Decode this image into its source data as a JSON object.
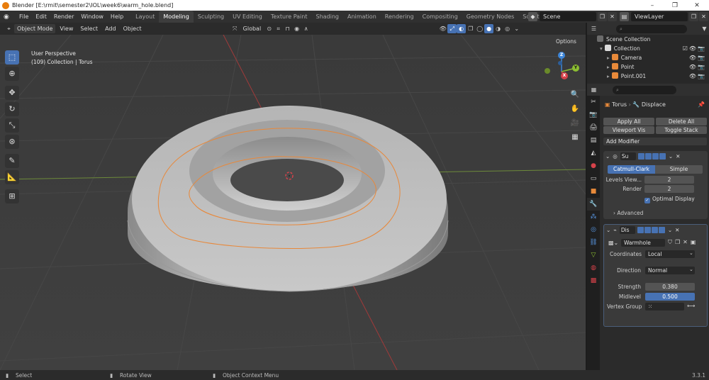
{
  "titlebar": {
    "title": "Blender [E:\\rmit\\semester2\\IOL\\week6\\warm_hole.blend]",
    "min": "–",
    "max": "❐",
    "close": "✕"
  },
  "menu": {
    "items": [
      "File",
      "Edit",
      "Render",
      "Window",
      "Help"
    ]
  },
  "workspace_tabs": [
    "Layout",
    "Modeling",
    "Sculpting",
    "UV Editing",
    "Texture Paint",
    "Shading",
    "Animation",
    "Rendering",
    "Compositing",
    "Geometry Nodes",
    "Scripting"
  ],
  "workspace_active": "Modeling",
  "scene": "Scene",
  "view_layer": "ViewLayer",
  "viewport_header": {
    "mode": "Object Mode",
    "menus": [
      "View",
      "Select",
      "Add",
      "Object"
    ],
    "transform_orientation": "Global"
  },
  "viewport": {
    "perspective": "User Perspective",
    "collection_info": "(109) Collection | Torus",
    "options_label": "Options",
    "gizmo": {
      "x": "X",
      "y": "Y",
      "z": "Z"
    }
  },
  "statusbar": {
    "select": "Select",
    "rotate": "Rotate View",
    "context": "Object Context Menu",
    "version": "3.3.1"
  },
  "outliner": {
    "root": "Scene Collection",
    "collection": "Collection",
    "items": [
      "Camera",
      "Point",
      "Point.001"
    ]
  },
  "properties": {
    "breadcrumb_object": "Torus",
    "breadcrumb_modifier": "Displace",
    "apply_all": "Apply All",
    "delete_all": "Delete All",
    "viewport_vis": "Viewport Vis",
    "toggle_stack": "Toggle Stack",
    "add_modifier": "Add Modifier",
    "subsurf": {
      "name": "Su",
      "catmull": "Catmull-Clark",
      "simple": "Simple",
      "levels_label": "Levels View...",
      "levels_value": "2",
      "render_label": "Render",
      "render_value": "2",
      "optimal": "Optimal Display",
      "advanced": "Advanced"
    },
    "displace": {
      "name": "Dis",
      "texture": "Warmhole",
      "coordinates_label": "Coordinates",
      "coordinates_value": "Local",
      "direction_label": "Direction",
      "direction_value": "Normal",
      "strength_label": "Strength",
      "strength_value": "0.380",
      "midlevel_label": "Midlevel",
      "midlevel_value": "0.500",
      "vgroup_label": "Vertex Group"
    }
  },
  "colors": {
    "accent": "#4772b3",
    "torus_outline": "#e8883a",
    "x_axis": "#d6424a",
    "y_axis": "#8cbe32",
    "z_axis": "#3e86d8"
  }
}
